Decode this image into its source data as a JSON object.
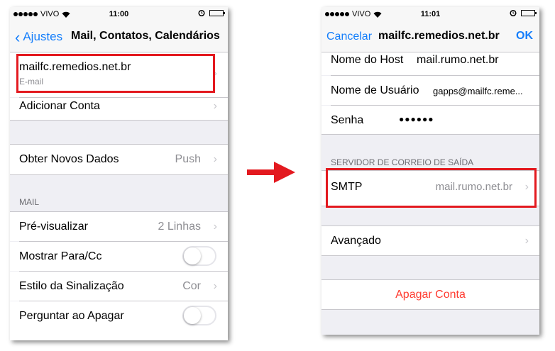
{
  "left": {
    "status": {
      "carrier": "VIVO",
      "time": "11:00"
    },
    "nav": {
      "back_label": "Ajustes",
      "title": "Mail, Contatos, Calendários"
    },
    "account": {
      "name": "mailfc.remedios.net.br",
      "type": "E-mail"
    },
    "add_account": "Adicionar Conta",
    "fetch": {
      "label": "Obter Novos Dados",
      "value": "Push"
    },
    "mail_header": "MAIL",
    "preview": {
      "label": "Pré-visualizar",
      "value": "2 Linhas"
    },
    "show_to_cc": {
      "label": "Mostrar Para/Cc",
      "on": false
    },
    "flag_style": {
      "label": "Estilo da Sinalização",
      "value": "Cor"
    },
    "ask_delete": {
      "label": "Perguntar ao Apagar",
      "on": false
    }
  },
  "right": {
    "status": {
      "carrier": "VIVO",
      "time": "11:01"
    },
    "nav": {
      "cancel_label": "Cancelar",
      "title": "mailfc.remedios.net.br",
      "ok_label": "OK"
    },
    "host": {
      "label": "Nome do Host",
      "value": "mail.rumo.net.br"
    },
    "username": {
      "label": "Nome de Usuário",
      "value": "gapps@mailfc.reme..."
    },
    "password": {
      "label": "Senha",
      "value": "●●●●●●"
    },
    "outgoing_header": "SERVIDOR DE CORREIO DE SAÍDA",
    "smtp": {
      "label": "SMTP",
      "value": "mail.rumo.net.br"
    },
    "advanced": "Avançado",
    "delete_account": "Apagar Conta"
  },
  "colors": {
    "ios_blue": "#147efb",
    "destructive_red": "#ff3b30",
    "highlight_red": "#e3191f"
  }
}
